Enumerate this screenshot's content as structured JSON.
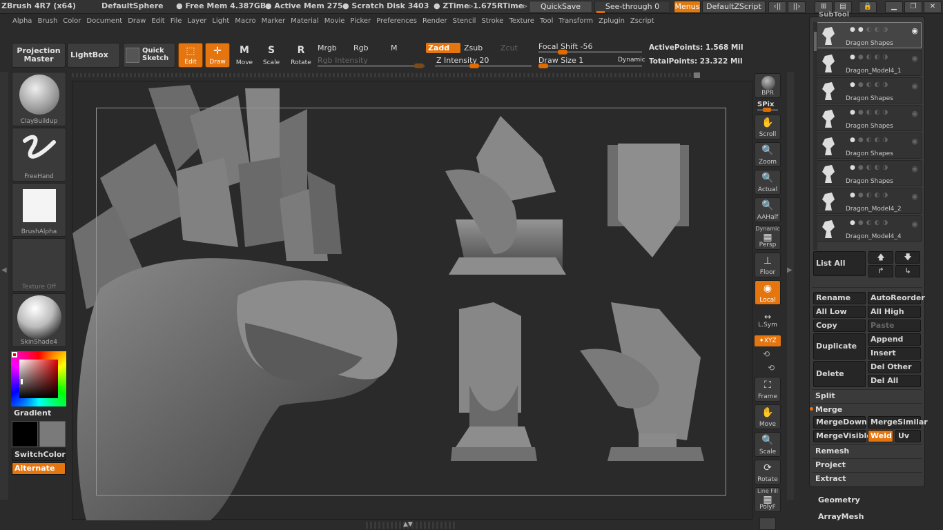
{
  "titlebar": {
    "app": "ZBrush 4R7 (x64)",
    "document": "DefaultSphere",
    "free_mem": "● Free Mem 4.387GB",
    "active_mem": "● Active Mem 275",
    "scratch": "● Scratch Disk 3403",
    "ztime": "● ZTime▹1.675",
    "rtime": "RTime▹",
    "quicksave": "QuickSave",
    "seethrough": "See-through  0",
    "menus": "Menus",
    "script": "DefaultZScript"
  },
  "menubar": [
    "Alpha",
    "Brush",
    "Color",
    "Document",
    "Draw",
    "Edit",
    "File",
    "Layer",
    "Light",
    "Macro",
    "Marker",
    "Material",
    "Movie",
    "Picker",
    "Preferences",
    "Render",
    "Stencil",
    "Stroke",
    "Texture",
    "Tool",
    "Transform",
    "Zplugin",
    "Zscript"
  ],
  "toolbar": {
    "projection_master": "Projection Master",
    "lightbox": "LightBox",
    "quick_sketch": "Quick Sketch",
    "edit": "Edit",
    "draw": "Draw",
    "move": "Move",
    "scale": "Scale",
    "rotate": "Rotate",
    "mrgb": "Mrgb",
    "rgb": "Rgb",
    "m": "M",
    "zadd": "Zadd",
    "zsub": "Zsub",
    "zcut": "Zcut",
    "rgb_intensity": "Rgb Intensity",
    "z_intensity": "Z Intensity 20",
    "focal_shift": "Focal Shift -56",
    "draw_size": "Draw Size 1",
    "dynamic": "Dynamic",
    "active_points": "ActivePoints: 1.568  Mil",
    "total_points": "TotalPoints: 23.322  Mil"
  },
  "left_shelf": {
    "brush": "ClayBuildup",
    "stroke": "FreeHand",
    "alpha": "BrushAlpha",
    "texture": "Texture Off",
    "material": "SkinShade4",
    "gradient": "Gradient",
    "switch_color": "SwitchColor",
    "alternate": "Alternate"
  },
  "right_shelf": {
    "bpr": "BPR",
    "spix": "SPix",
    "scroll": "Scroll",
    "zoom": "Zoom",
    "actual": "Actual",
    "aahalf": "AAHalf",
    "dynamic": "Dynamic",
    "persp": "Persp",
    "floor": "Floor",
    "local": "Local",
    "lsym": "L.Sym",
    "xyz": "✦XYZ",
    "frame": "Frame",
    "move": "Move",
    "scale": "Scale",
    "rotate": "Rotate",
    "line_fill": "Line Fill",
    "polyf": "PolyF"
  },
  "subtool": {
    "header": "SubTool",
    "items": [
      {
        "name": "Dragon Shapes",
        "selected": true
      },
      {
        "name": "Dragon_Model4_1",
        "selected": false
      },
      {
        "name": "Dragon Shapes",
        "selected": false
      },
      {
        "name": "Dragon Shapes",
        "selected": false
      },
      {
        "name": "Dragon Shapes",
        "selected": false
      },
      {
        "name": "Dragon Shapes",
        "selected": false
      },
      {
        "name": "Dragon_Model4_2",
        "selected": false
      },
      {
        "name": "Dragon_Model4_4",
        "selected": false
      }
    ],
    "list_all": "List All",
    "rename": "Rename",
    "autoreorder": "AutoReorder",
    "all_low": "All Low",
    "all_high": "All High",
    "copy": "Copy",
    "paste": "Paste",
    "duplicate": "Duplicate",
    "append": "Append",
    "insert": "Insert",
    "delete": "Delete",
    "del_other": "Del Other",
    "del_all": "Del All",
    "split": "Split",
    "merge": "Merge",
    "merge_down": "MergeDown",
    "merge_similar": "MergeSimilar",
    "merge_visible": "MergeVisible",
    "weld": "Weld",
    "uv": "Uv",
    "remesh": "Remesh",
    "project": "Project",
    "extract": "Extract",
    "geometry": "Geometry",
    "arraymesh": "ArrayMesh"
  },
  "colors": {
    "accent": "#e5750f",
    "panel": "#3a3a3a",
    "canvas": "#2a2a2a"
  }
}
